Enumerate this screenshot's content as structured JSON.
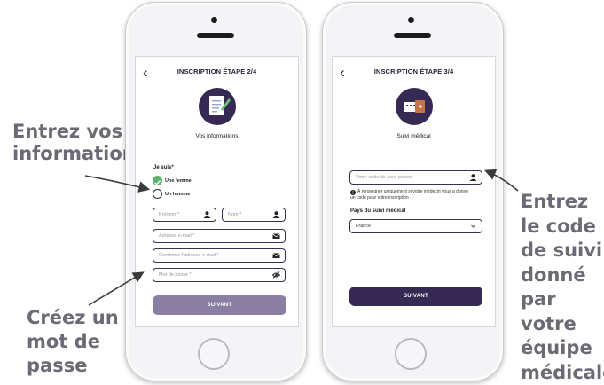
{
  "annotations": {
    "left_top": [
      "Entrez vos",
      "informations"
    ],
    "left_bottom": [
      "Créez un",
      "mot de",
      "passe"
    ],
    "right": [
      "Entrez",
      "le code",
      "de suivi",
      "donné",
      "par votre",
      "équipe",
      "médicale"
    ]
  },
  "colors": {
    "primary": "#362953",
    "primary_light": "#8a7fa3",
    "check": "#5db06a",
    "annot": "#6e6a75"
  },
  "screen1": {
    "title": "INSCRIPTION ÉTAPE 2/4",
    "back_icon": "chevron-left-icon",
    "hero_icon": "document-edit-icon",
    "subtitle": "Vos informations",
    "gender_label": "Je suis* :",
    "options": [
      "Une femme",
      "Un homme"
    ],
    "selected_option": "Une femme",
    "prenom_placeholder": "Prénom *",
    "nom_placeholder": "Nom *",
    "email_placeholder": "Adresse e-mail *",
    "confirm_email_placeholder": "Confirmer l'adresse e-mail *",
    "password_placeholder": "Mot de passe *",
    "button": "SUIVANT"
  },
  "screen2": {
    "title": "INSCRIPTION ÉTAPE 3/4",
    "back_icon": "chevron-left-icon",
    "hero_icon": "medical-kit-icon",
    "subtitle": "Suivi médical",
    "code_placeholder": "Votre code de suivi patient",
    "note": "À renseigner uniquement si votre médecin vous a donné un code pour votre inscription",
    "country_label": "Pays du suivi médical",
    "country_value": "France",
    "button": "SUIVANT"
  }
}
